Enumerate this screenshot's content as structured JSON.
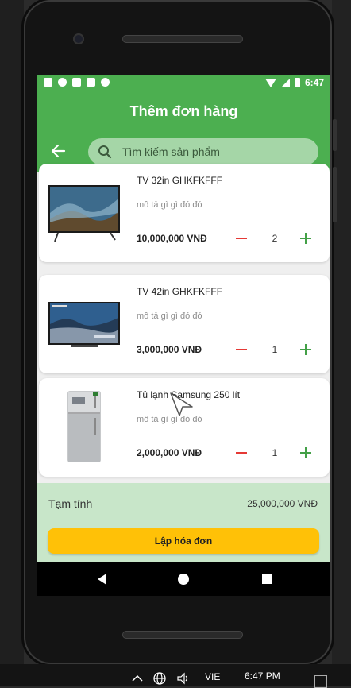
{
  "status_bar": {
    "time": "6:47"
  },
  "app_bar": {
    "title": "Thêm đơn hàng"
  },
  "search": {
    "placeholder": "Tìm kiếm sản phẩm"
  },
  "products": [
    {
      "name": "TV 32in GHKFKFFF",
      "description": "mô tả gì gì đó đó",
      "price": "10,000,000 VNĐ",
      "quantity": "2"
    },
    {
      "name": "TV 42in GHKFKFFF",
      "description": "mô tả gì gì đó đó",
      "price": "3,000,000 VNĐ",
      "quantity": "1"
    },
    {
      "name": "Tủ lạnh Samsung 250 lít",
      "description": "mô tả gì gì đó đó",
      "price": "2,000,000 VNĐ",
      "quantity": "1"
    }
  ],
  "summary": {
    "subtotal_label": "Tạm tính",
    "subtotal_value": "25,000,000 VNĐ",
    "invoice_button": "Lập hóa đơn"
  },
  "taskbar": {
    "language": "VIE",
    "time": "6:47 PM"
  },
  "colors": {
    "primary": "#4caf50",
    "search_bg": "#a5d6a7",
    "summary_bg": "#c8e6c9",
    "button": "#ffc107",
    "minus": "#e53935",
    "plus": "#43a047"
  }
}
